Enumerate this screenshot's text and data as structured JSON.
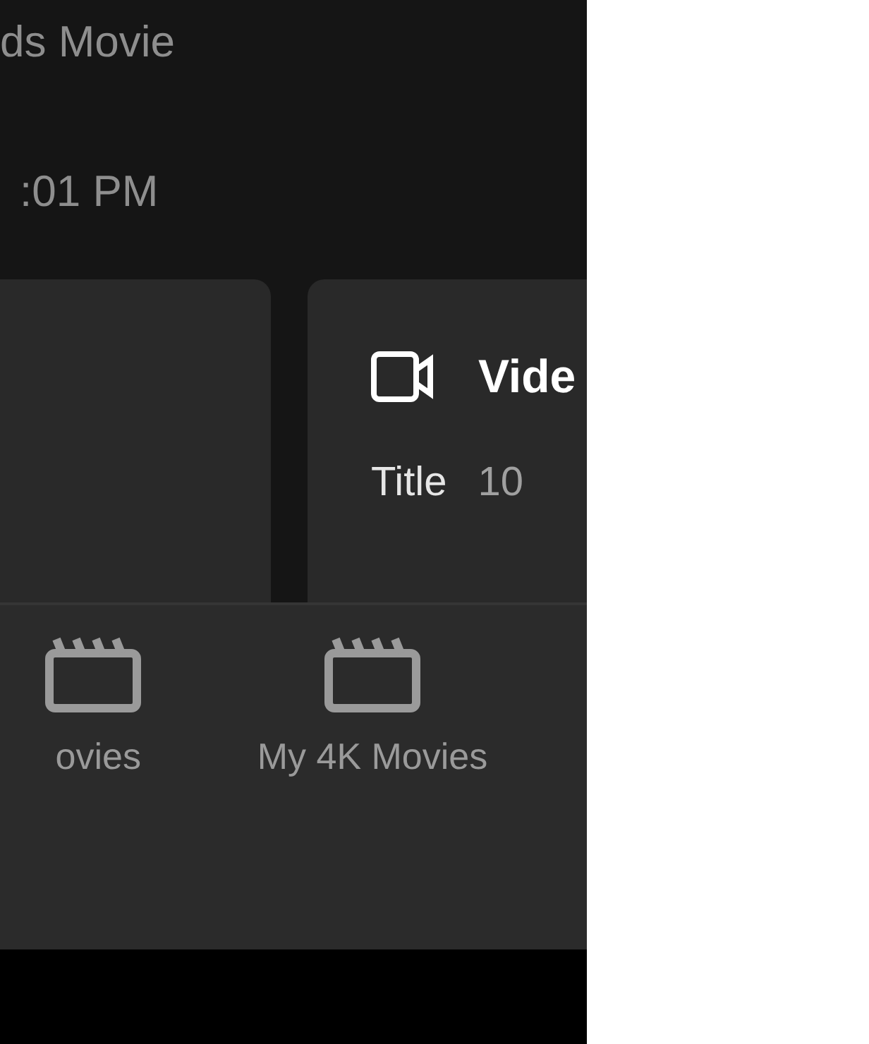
{
  "header": {
    "title": "ds Movie",
    "time": ":01 PM"
  },
  "video_card": {
    "heading": "Vide",
    "rows": [
      {
        "label": "Title",
        "value": "10"
      }
    ]
  },
  "tab_bar": [
    {
      "label": "ovies",
      "selected": false
    },
    {
      "label": "My 4K Movies",
      "selected": false
    }
  ]
}
